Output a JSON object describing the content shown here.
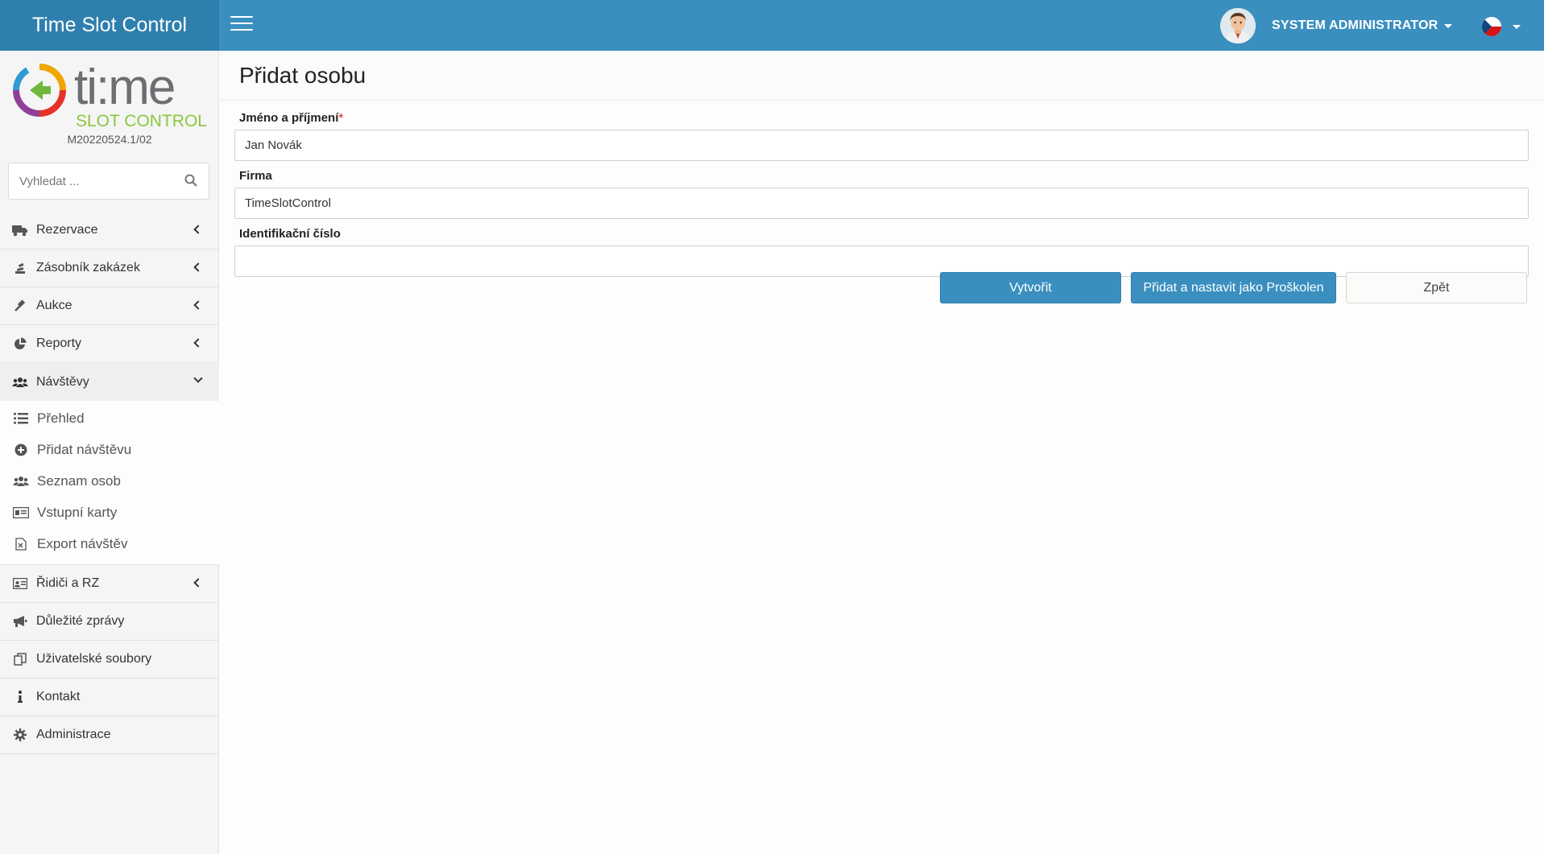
{
  "app": {
    "title": "Time Slot Control"
  },
  "header": {
    "user_name": "SYSTEM ADMINISTRATOR"
  },
  "logo": {
    "wordmark": "ti:me",
    "tagline": "SLOT CONTROL"
  },
  "sidebar": {
    "version": "M20220524.1/02",
    "search_placeholder": "Vyhledat ...",
    "items": [
      {
        "label": "Rezervace",
        "icon": "truck-icon"
      },
      {
        "label": "Zásobník zakázek",
        "icon": "stack-icon"
      },
      {
        "label": "Aukce",
        "icon": "gavel-icon"
      },
      {
        "label": "Reporty",
        "icon": "pie-chart-icon"
      },
      {
        "label": "Návštěvy",
        "icon": "users-icon"
      },
      {
        "label": "Řidiči a RZ",
        "icon": "id-card-icon"
      },
      {
        "label": "Důležité zprávy",
        "icon": "megaphone-icon"
      },
      {
        "label": "Uživatelské soubory",
        "icon": "files-icon"
      },
      {
        "label": "Kontakt",
        "icon": "info-icon"
      },
      {
        "label": "Administrace",
        "icon": "gear-icon"
      }
    ],
    "visits_sub": [
      {
        "label": "Přehled",
        "icon": "list-icon"
      },
      {
        "label": "Přidat návštěvu",
        "icon": "plus-circle-icon"
      },
      {
        "label": "Seznam osob",
        "icon": "users-icon"
      },
      {
        "label": "Vstupní karty",
        "icon": "card-icon"
      },
      {
        "label": "Export návštěv",
        "icon": "excel-file-icon"
      }
    ]
  },
  "page": {
    "title": "Přidat osobu"
  },
  "form": {
    "name_label": "Jméno a příjmení",
    "required_mark": "*",
    "name_value": "Jan Novák",
    "company_label": "Firma",
    "company_value": "TimeSlotControl",
    "id_label": "Identifikační číslo",
    "id_value": ""
  },
  "buttons": {
    "create": "Vytvořit",
    "add_trained": "Přidat a nastavit jako Proškolen",
    "back": "Zpět"
  },
  "colors": {
    "primary": "#3a8fbf",
    "brand_dark": "#2f7fae",
    "required": "#d9534f"
  }
}
